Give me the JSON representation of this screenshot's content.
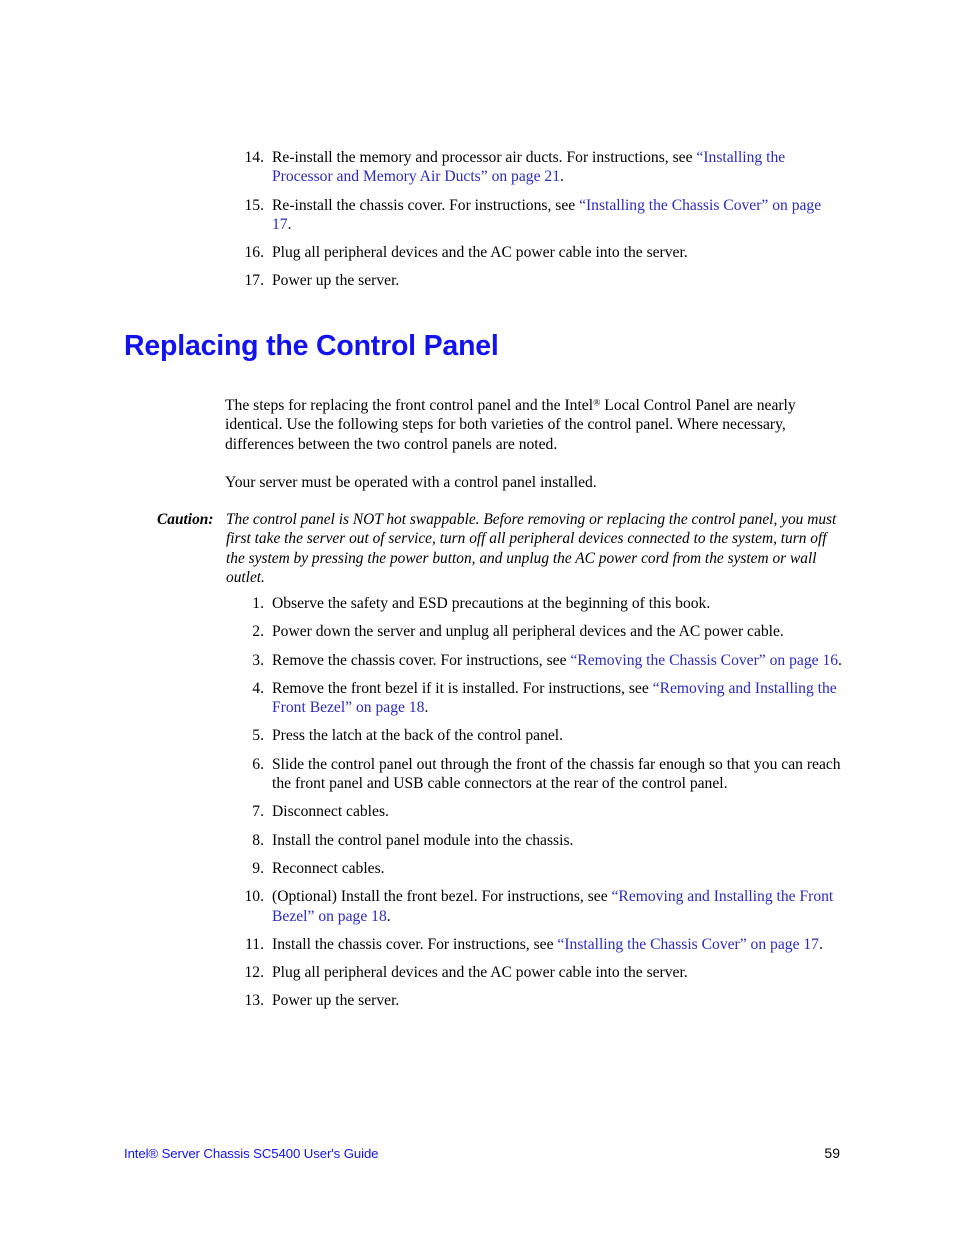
{
  "document": {
    "footer_title": "Intel® Server Chassis SC5400 User's Guide",
    "page_number": "59",
    "link_color": "#2B2BC0",
    "heading_color": "#1212F0",
    "body_color": "#000000"
  },
  "top_steps": [
    {
      "num": "14.",
      "pre": "Re-install the memory and processor air ducts. For instructions, see ",
      "link": "“Installing the Processor and Memory Air Ducts” on page 21",
      "post": "."
    },
    {
      "num": "15.",
      "pre": "Re-install the chassis cover. For instructions, see ",
      "link": "“Installing the Chassis Cover” on page 17",
      "post": "."
    },
    {
      "num": "16.",
      "pre": "Plug all peripheral devices and the AC power cable into the server.",
      "link": "",
      "post": ""
    },
    {
      "num": "17.",
      "pre": "Power up the server.",
      "link": "",
      "post": ""
    }
  ],
  "heading": "Replacing the Control Panel",
  "intro": {
    "para1_a": "The steps for replacing the front control panel and the Intel",
    "para1_sup": "®",
    "para1_b": " Local Control Panel are nearly identical. Use the following steps for both varieties of the control panel. Where necessary, differences between the two control panels are noted.",
    "para2": "Your server must be operated with a control panel installed."
  },
  "caution": {
    "label": "Caution:",
    "text": "The control panel is NOT hot swappable. Before removing or replacing the control panel, you must first take the server out of service, turn off all peripheral devices connected to the system, turn off the system by pressing the power button, and unplug the AC power cord from the system or wall outlet."
  },
  "main_steps": [
    {
      "num": "1.",
      "pre": "Observe the safety and ESD precautions at the beginning of this book.",
      "link": "",
      "post": ""
    },
    {
      "num": "2.",
      "pre": "Power down the server and unplug all peripheral devices and the AC power cable.",
      "link": "",
      "post": ""
    },
    {
      "num": "3.",
      "pre": "Remove the chassis cover. For instructions, see ",
      "link": "“Removing the Chassis Cover” on page 16",
      "post": "."
    },
    {
      "num": "4.",
      "pre": "Remove the front bezel if it is installed. For instructions, see ",
      "link": "“Removing and Installing the Front Bezel” on page 18",
      "post": "."
    },
    {
      "num": "5.",
      "pre": "Press the latch at the back of the control panel.",
      "link": "",
      "post": ""
    },
    {
      "num": "6.",
      "pre": "Slide the control panel out through the front of the chassis far enough so that you can reach the front panel and USB cable connectors at the rear of the control panel.",
      "link": "",
      "post": ""
    },
    {
      "num": "7.",
      "pre": "Disconnect cables.",
      "link": "",
      "post": ""
    },
    {
      "num": "8.",
      "pre": "Install the control panel module into the chassis.",
      "link": "",
      "post": ""
    },
    {
      "num": "9.",
      "pre": "Reconnect cables.",
      "link": "",
      "post": ""
    },
    {
      "num": "10.",
      "pre": "(Optional) Install the front bezel. For instructions, see ",
      "link": "“Removing and Installing the Front Bezel” on page 18",
      "post": "."
    },
    {
      "num": "11.",
      "pre": "Install the chassis cover. For instructions, see ",
      "link": "“Installing the Chassis Cover” on page 17",
      "post": "."
    },
    {
      "num": "12.",
      "pre": "Plug all peripheral devices and the AC power cable into the server.",
      "link": "",
      "post": ""
    },
    {
      "num": "13.",
      "pre": "Power up the server.",
      "link": "",
      "post": ""
    }
  ]
}
